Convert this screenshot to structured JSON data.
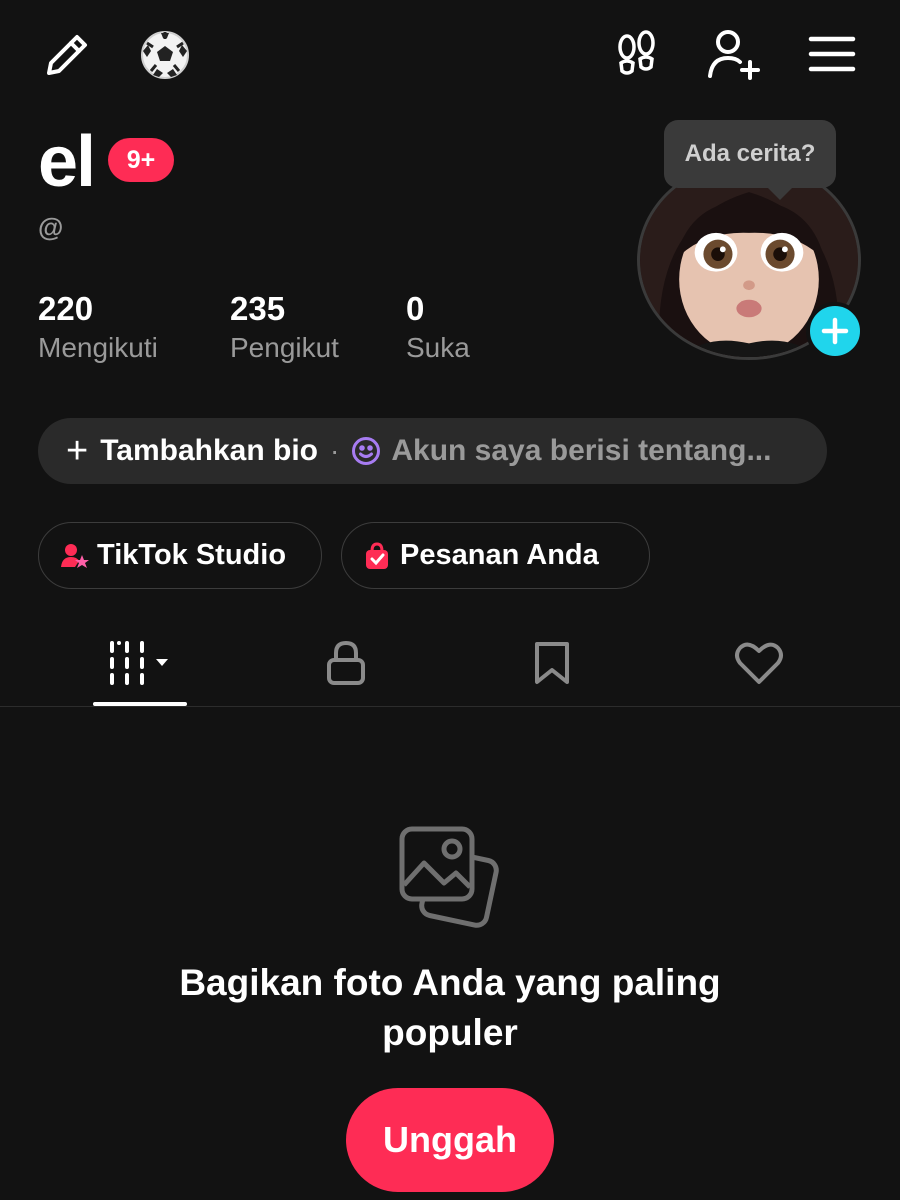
{
  "header": {
    "icons": {
      "edit": "pencil-icon",
      "interest": "soccer-ball-icon",
      "visitors": "footprints-icon",
      "add_friend": "add-user-icon",
      "menu": "hamburger-menu-icon"
    }
  },
  "profile": {
    "username": "el",
    "notification_badge": "9+",
    "handle": "@",
    "story_prompt": "Ada cerita?"
  },
  "stats": {
    "following": {
      "value": "220",
      "label": "Mengikuti"
    },
    "followers": {
      "value": "235",
      "label": "Pengikut"
    },
    "likes": {
      "value": "0",
      "label": "Suka"
    }
  },
  "bio": {
    "add_label": "Tambahkan bio",
    "separator": "·",
    "suggestion": "Akun saya berisi tentang..."
  },
  "chips": {
    "studio": "TikTok Studio",
    "orders": "Pesanan Anda"
  },
  "tabs": [
    "videos-grid-icon",
    "lock-icon",
    "bookmark-icon",
    "heart-icon"
  ],
  "empty_state": {
    "title": "Bagikan foto Anda yang paling populer",
    "upload_button": "Unggah"
  },
  "colors": {
    "background": "#121212",
    "accent": "#fe2c55",
    "avatar_plus": "#20d5ec",
    "muted_text": "#9a9a9a"
  }
}
